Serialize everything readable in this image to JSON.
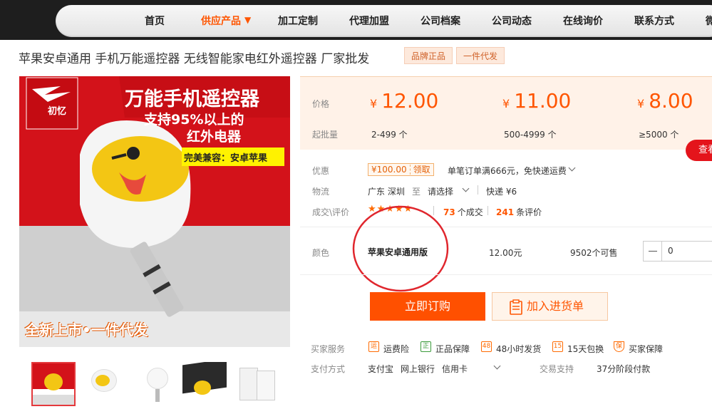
{
  "nav": {
    "items": [
      "首页",
      "供应产品",
      "加工定制",
      "代理加盟",
      "公司档案",
      "公司动态",
      "在线询价",
      "联系方式",
      "微"
    ],
    "active_index": 1,
    "dropdown_glyph": "▼"
  },
  "product": {
    "title": "苹果安卓通用 手机万能遥控器 无线智能家电红外遥控器 厂家批发",
    "tags": [
      "品牌正品",
      "一件代发"
    ]
  },
  "image": {
    "brand": "初忆",
    "headline": "万能手机遥控器",
    "line1": "支持95%以上的",
    "line2": "红外电器",
    "compat": "完美兼容：安卓苹果",
    "bottom": "全新上市•一件代发"
  },
  "pricing": {
    "price_label": "价格",
    "batch_label": "起批量",
    "currency": "¥",
    "tiers": [
      {
        "price": "12.00",
        "qty": "2-499 个"
      },
      {
        "price": "11.00",
        "qty": "500-4999 个"
      },
      {
        "price": "8.00",
        "qty": "≥5000 个"
      }
    ],
    "side_button": "查看"
  },
  "promo": {
    "label": "优惠",
    "coupon_value": "¥100.00",
    "coupon_action": "领取",
    "text": "单笔订单满666元，免快递运费"
  },
  "logistics": {
    "label": "物流",
    "origin": "广东 深圳",
    "to": "至",
    "destination": "请选择",
    "express": "快递 ¥6"
  },
  "reviews": {
    "label": "成交\\评价",
    "stars": "★★★★★",
    "rating": 5,
    "deals_num": "73",
    "deals_text": "个成交",
    "reviews_num": "241",
    "reviews_text": "条评价"
  },
  "variant": {
    "label": "颜色",
    "name": "苹果安卓通用版",
    "price": "12.00元",
    "stock": "9502个可售",
    "quantity": "0"
  },
  "actions": {
    "buy": "立即订购",
    "cart": "加入进货单"
  },
  "services": {
    "label": "买家服务",
    "items": [
      {
        "icon": "运",
        "text": "运费险"
      },
      {
        "icon": "正",
        "text": "正品保障"
      },
      {
        "icon": "48",
        "text": "48小时发货"
      },
      {
        "icon": "15",
        "text": "15天包换"
      },
      {
        "icon": "保",
        "text": "买家保障"
      }
    ]
  },
  "payment": {
    "label": "支付方式",
    "methods": [
      "支付宝",
      "网上银行",
      "信用卡"
    ],
    "trade_label": "交易支持",
    "trade_value": "37分阶段付款"
  },
  "colors": {
    "accent": "#ff5500",
    "buy_button": "#ff5000",
    "nav_bg": "#1e1e1e",
    "price_bg": "#fff2e8",
    "circle": "#e0262d"
  }
}
